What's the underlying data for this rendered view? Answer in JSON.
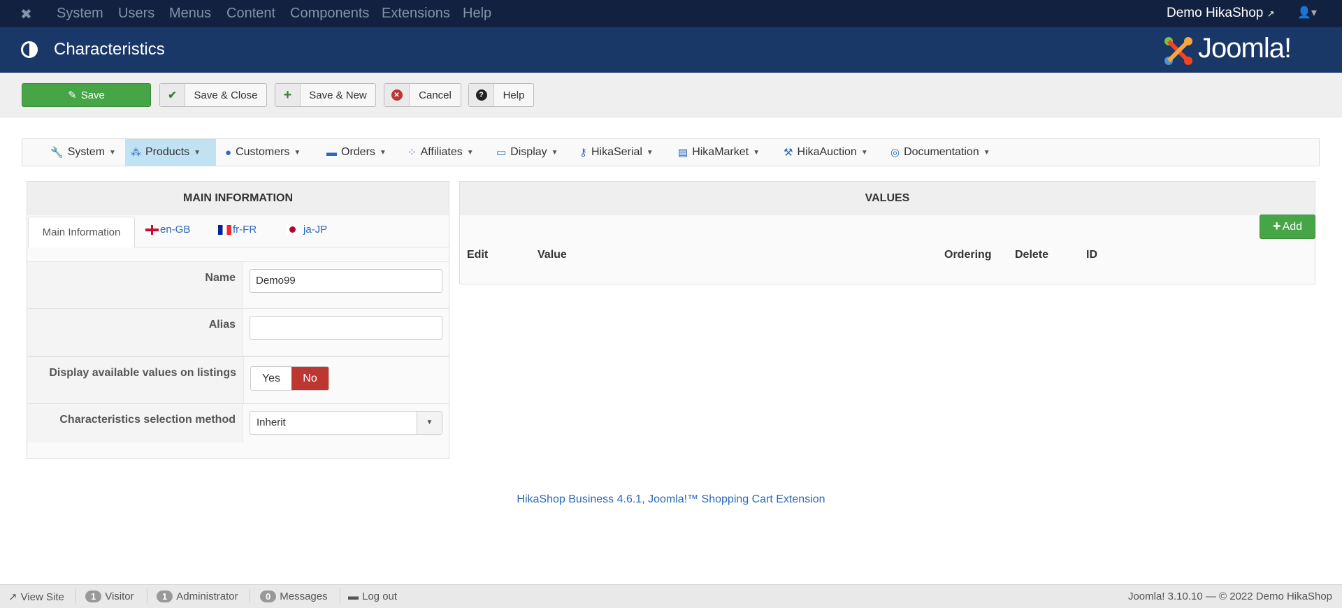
{
  "topbar": {
    "menu": [
      "System",
      "Users",
      "Menus",
      "Content",
      "Components",
      "Extensions",
      "Help"
    ],
    "site_link": "Demo HikaShop"
  },
  "header": {
    "title": "Characteristics",
    "logo_text": "Joomla!"
  },
  "toolbar": {
    "save": "Save",
    "save_close": "Save & Close",
    "save_new": "Save & New",
    "cancel": "Cancel",
    "help": "Help"
  },
  "submenu": [
    {
      "label": "System",
      "icon": "wrench"
    },
    {
      "label": "Products",
      "icon": "cubes"
    },
    {
      "label": "Customers",
      "icon": "user"
    },
    {
      "label": "Orders",
      "icon": "credit-card"
    },
    {
      "label": "Affiliates",
      "icon": "users"
    },
    {
      "label": "Display",
      "icon": "desktop"
    },
    {
      "label": "HikaSerial",
      "icon": "key"
    },
    {
      "label": "HikaMarket",
      "icon": "store"
    },
    {
      "label": "HikaAuction",
      "icon": "gavel"
    },
    {
      "label": "Documentation",
      "icon": "life-ring"
    }
  ],
  "main_info": {
    "title": "MAIN INFORMATION",
    "tabs": [
      "Main Information",
      "en-GB",
      "fr-FR",
      "ja-JP"
    ],
    "name_label": "Name",
    "name_value": "Demo99",
    "alias_label": "Alias",
    "alias_value": "",
    "display_label": "Display available values on listings",
    "yes": "Yes",
    "no": "No",
    "method_label": "Characteristics selection method",
    "method_value": "Inherit"
  },
  "values": {
    "title": "VALUES",
    "add": "Add",
    "columns": [
      "Edit",
      "Value",
      "Ordering",
      "Delete",
      "ID"
    ]
  },
  "footer": {
    "text": "HikaShop Business 4.6.1, Joomla!™ Shopping Cart Extension"
  },
  "status": {
    "view_site": "View Site",
    "visitors": "1",
    "visitor_label": "Visitor",
    "admins": "1",
    "admin_label": "Administrator",
    "messages": "0",
    "messages_label": "Messages",
    "logout": "Log out",
    "version": "Joomla! 3.10.10 — © 2022 Demo HikaShop"
  }
}
